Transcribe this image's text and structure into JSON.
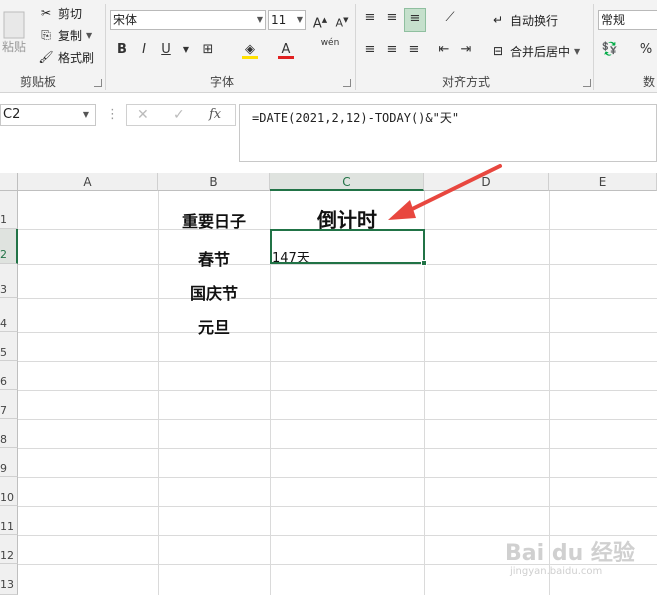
{
  "clipboard": {
    "paste_label": "粘贴",
    "cut_label": "剪切",
    "copy_label": "复制",
    "format_painter_label": "格式刷",
    "group_label": "剪贴板"
  },
  "font": {
    "font_name": "宋体",
    "font_size": "11",
    "bold": "B",
    "italic": "I",
    "underline": "U",
    "grow": "A",
    "shrink": "A",
    "pinyin": "wén",
    "group_label": "字体"
  },
  "alignment": {
    "wrap_text_label": "自动换行",
    "merge_center_label": "合并后居中",
    "group_label": "对齐方式"
  },
  "number": {
    "format_value": "常规",
    "group_label": "数",
    "percent": "%"
  },
  "formula_bar": {
    "name_box": "C2",
    "fx": "fx",
    "formula": "=DATE(2021,2,12)-TODAY()&\"天\""
  },
  "columns": [
    "A",
    "B",
    "C",
    "D",
    "E"
  ],
  "rows": [
    "1",
    "2",
    "3",
    "4",
    "5",
    "6",
    "7",
    "8",
    "9",
    "10",
    "11",
    "12",
    "13"
  ],
  "cells": {
    "B1": "重要日子",
    "C1": "倒计时",
    "B2": "春节",
    "C2": "147天",
    "B3": "国庆节",
    "B4": "元旦"
  },
  "watermark": {
    "brand": "Bai du 经验",
    "url": "jingyan.baidu.com"
  },
  "colors": {
    "accent": "#217346",
    "arrow": "#e8473f"
  }
}
